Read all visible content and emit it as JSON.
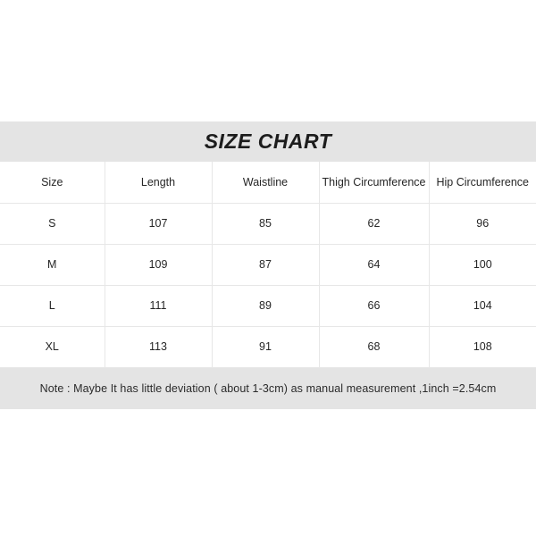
{
  "card": {
    "title": "SIZE CHART",
    "note": "Note : Maybe It has little deviation ( about 1-3cm) as manual measurement ,1inch =2.54cm",
    "colors": {
      "band_background": "#e4e4e4",
      "cell_background": "#ffffff",
      "grid_line": "#e7e7e7",
      "text": "#262626",
      "page_background": "#ffffff"
    }
  },
  "chart_data": {
    "type": "table",
    "title": "SIZE CHART",
    "columns": [
      "Size",
      "Length",
      "Waistline",
      "Thigh Circumference",
      "Hip Circumference"
    ],
    "rows": [
      [
        "S",
        "107",
        "85",
        "62",
        "96"
      ],
      [
        "M",
        "109",
        "87",
        "64",
        "100"
      ],
      [
        "L",
        "111",
        "89",
        "66",
        "104"
      ],
      [
        "XL",
        "113",
        "91",
        "68",
        "108"
      ]
    ],
    "units": "cm",
    "note": "Note : Maybe It has little deviation ( about 1-3cm) as manual measurement ,1inch =2.54cm"
  }
}
